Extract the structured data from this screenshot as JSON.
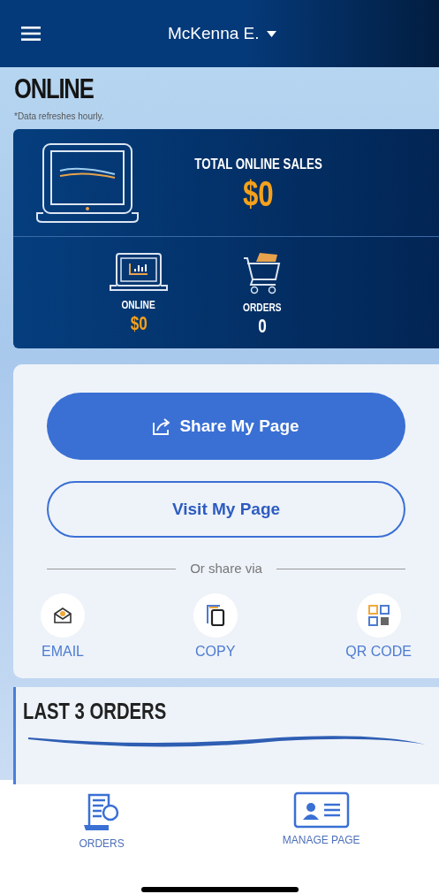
{
  "header": {
    "title": "McKenna E."
  },
  "section": {
    "title": "ONLINE",
    "note": "*Data refreshes hourly."
  },
  "summary": {
    "label": "TOTAL ONLINE SALES",
    "value": "$0",
    "stats": [
      {
        "label": "ONLINE",
        "value": "$0",
        "kind": "money"
      },
      {
        "label": "ORDERS",
        "value": "0",
        "kind": "count"
      }
    ]
  },
  "share": {
    "primary_button": "Share My Page",
    "secondary_button": "Visit My Page",
    "divider": "Or share via",
    "options": [
      {
        "label": "EMAIL",
        "kind": "email"
      },
      {
        "label": "COPY",
        "kind": "copy"
      },
      {
        "label": "QR CODE",
        "kind": "qr"
      }
    ]
  },
  "last_orders": {
    "title": "LAST 3 ORDERS"
  },
  "bottom_nav": [
    {
      "label": "ORDERS",
      "kind": "orders"
    },
    {
      "label": "MANAGE PAGE",
      "kind": "manage"
    }
  ]
}
